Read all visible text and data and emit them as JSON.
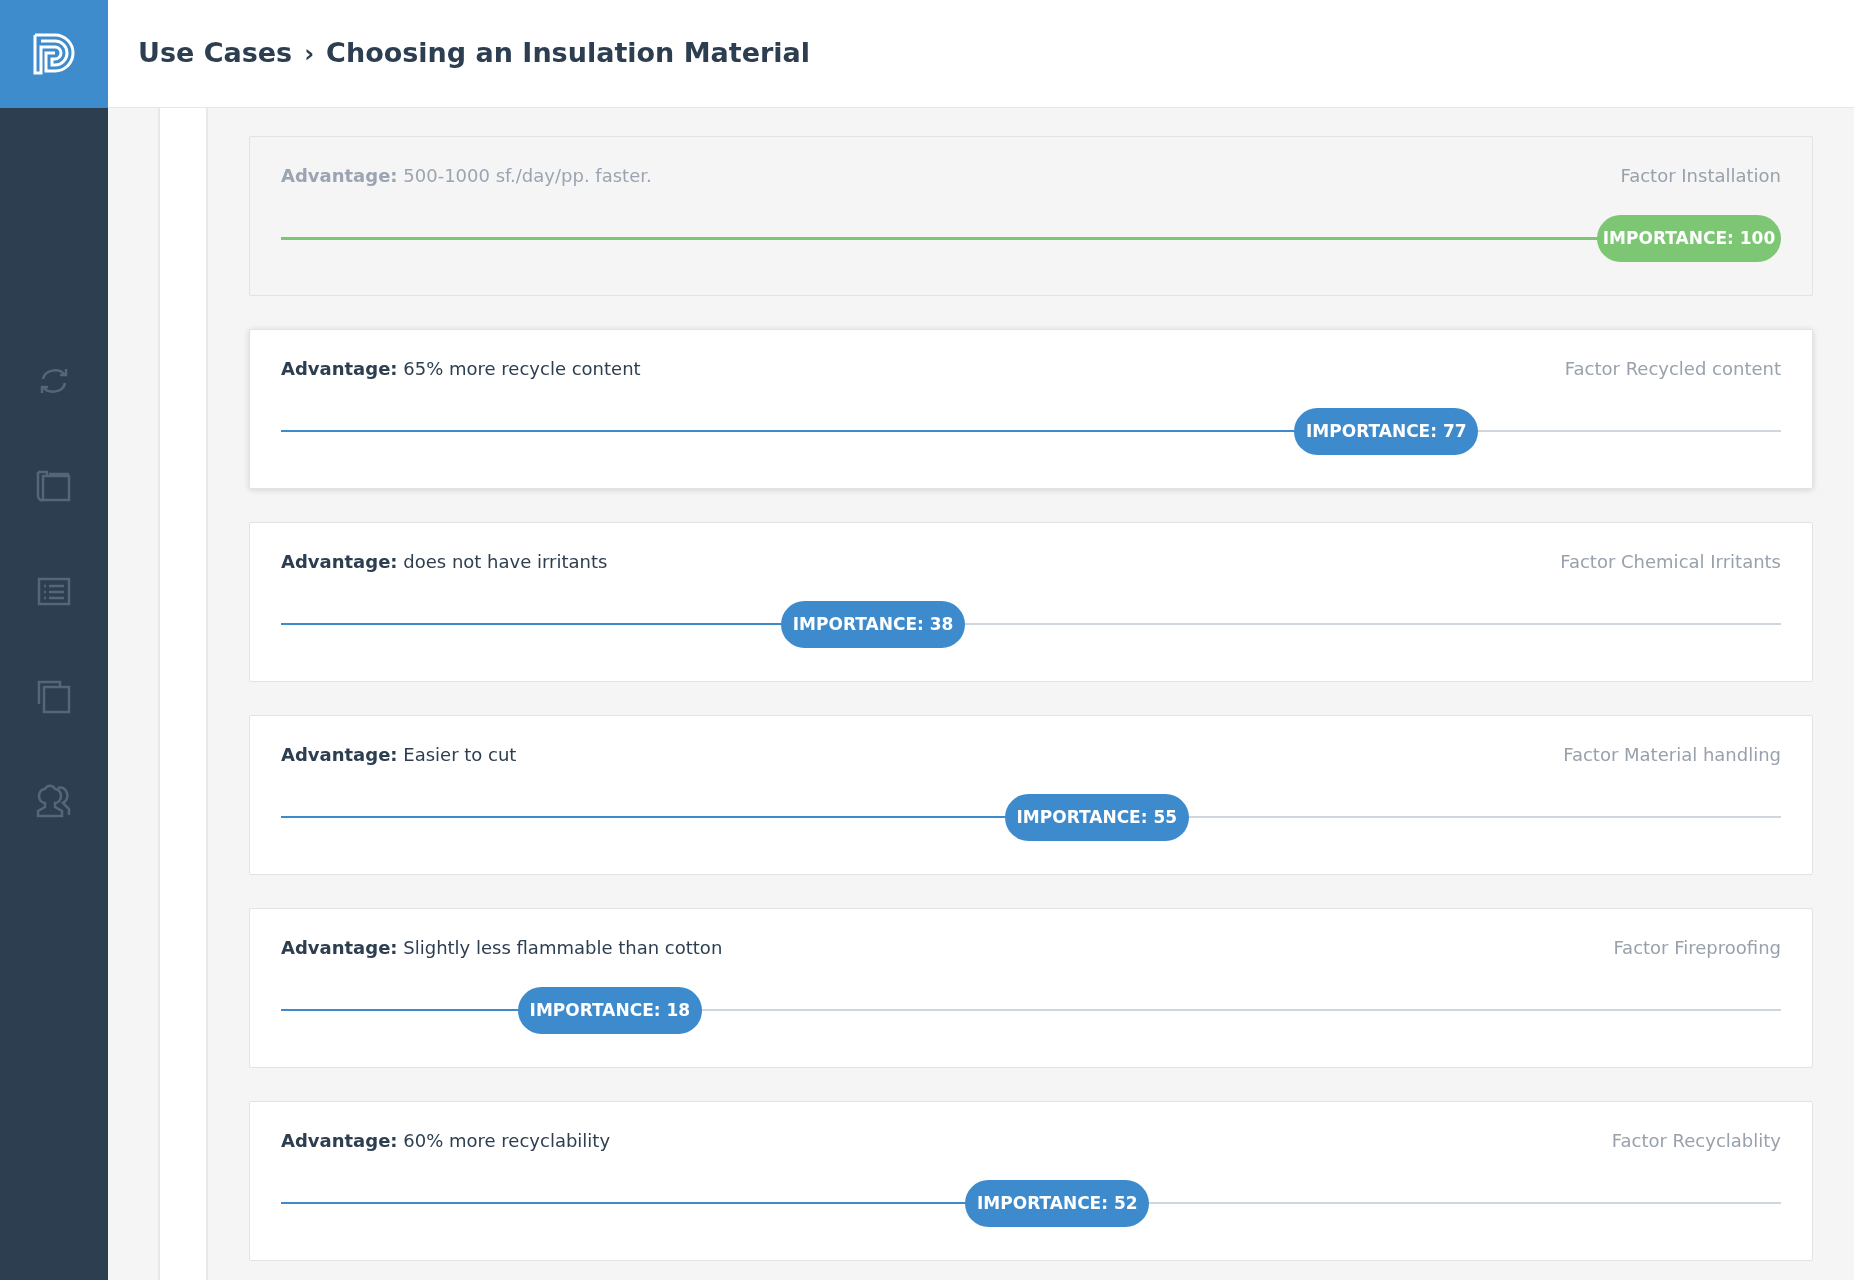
{
  "header": {
    "breadcrumb": [
      {
        "label": "Use Cases"
      },
      {
        "label": "Choosing an Insulation Material"
      }
    ],
    "separator": "›"
  },
  "sidebar": {
    "items": [
      {
        "kind": "sync"
      },
      {
        "kind": "folder"
      },
      {
        "kind": "list"
      },
      {
        "kind": "copy"
      },
      {
        "kind": "users"
      }
    ]
  },
  "advantages": [
    {
      "text": "**Advantage:** 500-1000 sf./day/pp. faster.",
      "factor": "Factor Installation",
      "importance": "IMPORTANCE: 100",
      "level": 1.0,
      "done": true,
      "focused": false
    },
    {
      "text": "**Advantage:** 65% more recycle content",
      "factor": "Factor Recycled content",
      "importance": "IMPORTANCE: 77",
      "level": 0.77,
      "done": false,
      "focused": true
    },
    {
      "text": "**Advantage:** does not have irritants",
      "factor": "Factor Chemical Irritants",
      "importance": "IMPORTANCE: 38",
      "level": 0.38,
      "done": false,
      "focused": false
    },
    {
      "text": "**Advantage:** Easier to cut",
      "factor": "Factor Material handling",
      "importance": "IMPORTANCE: 55",
      "level": 0.55,
      "done": false,
      "focused": false
    },
    {
      "text": "**Advantage:** Slightly less flammable than cotton",
      "factor": "Factor Fireproofing",
      "importance": "IMPORTANCE: 18",
      "level": 0.18,
      "done": false,
      "focused": false
    },
    {
      "text": "**Advantage:** 60% more recyclability",
      "factor": "Factor Recyclablity",
      "importance": "IMPORTANCE: 52",
      "level": 0.52,
      "done": false,
      "focused": false
    }
  ]
}
